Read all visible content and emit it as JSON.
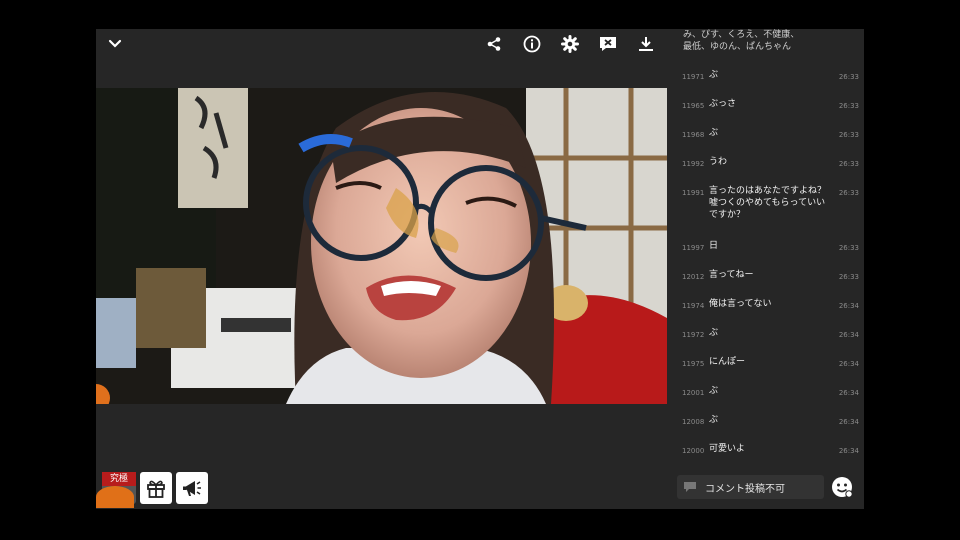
{
  "player": {
    "icons": [
      "chevron-down-icon",
      "share-icon",
      "info-icon",
      "gear-icon",
      "comment-off-icon",
      "download-icon"
    ]
  },
  "bottom": {
    "badge": "究極"
  },
  "chat": {
    "header_text": "み、ぴす、くろえ、不健康、\n最低、ゆのん、ぱんちゃん",
    "messages": [
      {
        "num": "11971",
        "text": "ぶ",
        "time": "26:33"
      },
      {
        "num": "11965",
        "text": "ぶっさ",
        "time": "26:33"
      },
      {
        "num": "11968",
        "text": "ぶ",
        "time": "26:33"
      },
      {
        "num": "11992",
        "text": "うわ",
        "time": "26:33"
      },
      {
        "num": "11991",
        "text": "言ったのはあなたですよね？\n嘘つくのやめてもらっていい\nですか？",
        "time": "26:33"
      },
      {
        "num": "11997",
        "text": "日",
        "time": "26:33"
      },
      {
        "num": "12012",
        "text": "言ってねー",
        "time": "26:33"
      },
      {
        "num": "11974",
        "text": "俺は言ってない",
        "time": "26:34"
      },
      {
        "num": "11972",
        "text": "ぶ",
        "time": "26:34"
      },
      {
        "num": "11975",
        "text": "にんぽー",
        "time": "26:34"
      },
      {
        "num": "12001",
        "text": "ぶ",
        "time": "26:34"
      },
      {
        "num": "12008",
        "text": "ぶ",
        "time": "26:34"
      },
      {
        "num": "12000",
        "text": "可愛いよ",
        "time": "26:34"
      }
    ],
    "input_placeholder": "コメント投稿不可"
  }
}
